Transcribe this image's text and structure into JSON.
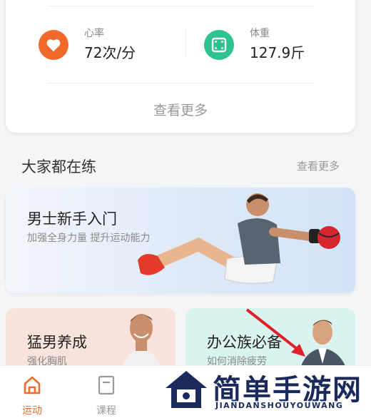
{
  "health": {
    "heart_rate": {
      "label": "心率",
      "value": "72次/分"
    },
    "weight": {
      "label": "体重",
      "value": "127.9斤"
    },
    "see_more": "查看更多"
  },
  "section": {
    "title": "大家都在练",
    "see_more": "查看更多"
  },
  "featured": {
    "title": "男士新手入门",
    "subtitle": "加强全身力量 提升运动能力"
  },
  "cards": [
    {
      "title": "猛男养成",
      "subtitle": "强化胸肌"
    },
    {
      "title": "办公族必备",
      "subtitle": "如何消除疲劳"
    }
  ],
  "nav": {
    "items": [
      {
        "label": "运动",
        "active": true
      },
      {
        "label": "课程",
        "active": false
      },
      {
        "label": "",
        "active": false
      },
      {
        "label": "",
        "active": false
      },
      {
        "label": "",
        "active": false
      }
    ]
  },
  "watermark": {
    "title": "简单手游网",
    "subtitle": "JIANDANSHOUYOUWANG"
  },
  "colors": {
    "accent": "#f26a2b",
    "weight_icon": "#2ec28e",
    "watermark": "#1a2a5c"
  }
}
